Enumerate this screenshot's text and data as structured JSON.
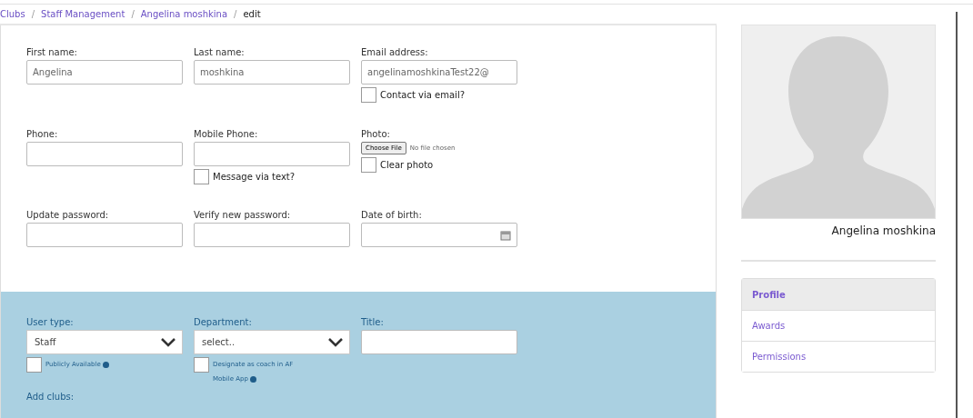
{
  "breadcrumb_separator": "/",
  "breadcrumb": [
    {
      "label": "Clubs",
      "kind": "link"
    },
    {
      "label": "Staff Management",
      "kind": "link"
    },
    {
      "label": "Angelina moshkina",
      "kind": "link"
    },
    {
      "label": "edit",
      "kind": "current"
    }
  ],
  "personal_section": {
    "rows": [
      [
        {
          "kind": "text",
          "label": "First name:",
          "value": "Angelina"
        },
        {
          "kind": "text",
          "label": "Last name:",
          "value": "moshkina"
        },
        {
          "kind": "text",
          "label": "Email address:",
          "value": "angelinamoshkinaTest22@",
          "checkbox": {
            "label": "Contact via email?",
            "checked": false
          }
        }
      ],
      [
        {
          "kind": "text",
          "label": "Phone:"
        },
        {
          "kind": "text",
          "label": "Mobile Phone:",
          "checkbox": {
            "label": "Message via text?",
            "checked": false
          }
        },
        {
          "kind": "file",
          "label": "Photo:",
          "button": "Choose File",
          "status": "No file chosen",
          "checkbox": {
            "label": "Clear photo",
            "checked": false
          }
        }
      ],
      [
        {
          "kind": "text",
          "label": "Update password:"
        },
        {
          "kind": "text",
          "label": "Verify new password:"
        },
        {
          "kind": "date",
          "label": "Date of birth:"
        }
      ]
    ]
  },
  "role_section": {
    "fields": [
      {
        "kind": "select",
        "label": "User type:",
        "value": "Staff",
        "checkbox": {
          "label": "Publicly Available",
          "checked": false
        }
      },
      {
        "kind": "select",
        "label": "Department:",
        "value": "select..",
        "checkbox": {
          "label": "Designate as coach in AF Mobile App",
          "checked": false
        }
      },
      {
        "kind": "text",
        "label": "Title:"
      }
    ],
    "add_clubs_label": "Add clubs:"
  },
  "profile": {
    "name": "Angelina moshkina",
    "menu": [
      {
        "label": "Profile",
        "selected": true
      },
      {
        "label": "Awards",
        "selected": false
      },
      {
        "label": "Permissions",
        "selected": false
      }
    ]
  }
}
